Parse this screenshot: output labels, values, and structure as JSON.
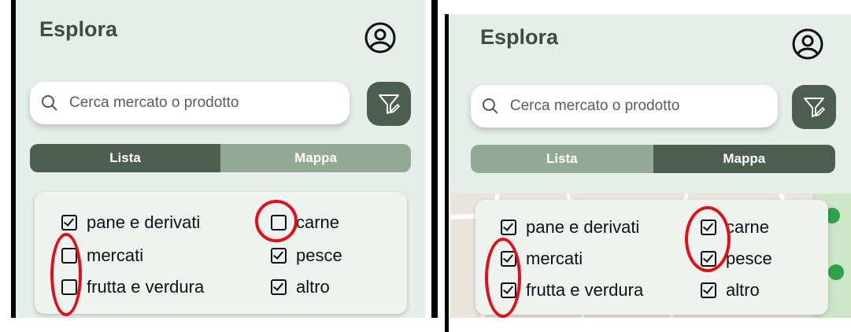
{
  "left": {
    "title": "Esplora",
    "search_placeholder": "Cerca mercato o prodotto",
    "tabs": [
      {
        "label": "Lista",
        "active": true
      },
      {
        "label": "Mappa",
        "active": false
      }
    ],
    "filters": [
      {
        "label": "pane e derivati",
        "checked": true
      },
      {
        "label": "mercati",
        "checked": false
      },
      {
        "label": "frutta e verdura",
        "checked": false
      },
      {
        "label": "carne",
        "checked": false
      },
      {
        "label": "pesce",
        "checked": true
      },
      {
        "label": "altro",
        "checked": true
      }
    ]
  },
  "right": {
    "title": "Esplora",
    "search_placeholder": "Cerca mercato o prodotto",
    "tabs": [
      {
        "label": "Lista",
        "active": false
      },
      {
        "label": "Mappa",
        "active": true
      }
    ],
    "filters": [
      {
        "label": "pane e derivati",
        "checked": true
      },
      {
        "label": "mercati",
        "checked": true
      },
      {
        "label": "frutta e verdura",
        "checked": true
      },
      {
        "label": "carne",
        "checked": true
      },
      {
        "label": "pesce",
        "checked": true
      },
      {
        "label": "altro",
        "checked": true
      }
    ]
  },
  "colors": {
    "primary": "#4d5e51",
    "secondary": "#91a995",
    "annotation": "#e0101a",
    "background": "#e6eee9"
  }
}
